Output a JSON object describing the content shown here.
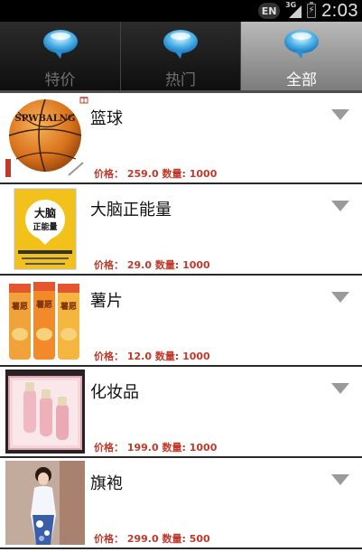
{
  "status_bar": {
    "language": "EN",
    "network": "3G",
    "time": "2:03"
  },
  "tabs": [
    {
      "label": "特价",
      "selected": false
    },
    {
      "label": "热门",
      "selected": false
    },
    {
      "label": "全部",
      "selected": true
    }
  ],
  "products": [
    {
      "name": "篮球",
      "price_label": "价格：",
      "price": "259.0",
      "qty_label": "数量:",
      "qty": "1000",
      "image": "basketball",
      "thumb_text": "SPWBALNG"
    },
    {
      "name": "大脑正能量",
      "price_label": "价格：",
      "price": "29.0",
      "qty_label": "数量:",
      "qty": "1000",
      "image": "book-cover",
      "thumb_text": "大脑正能量"
    },
    {
      "name": "薯片",
      "price_label": "价格：",
      "price": "12.0",
      "qty_label": "数量:",
      "qty": "1000",
      "image": "chips-cans",
      "thumb_text": "薯愿"
    },
    {
      "name": "化妆品",
      "price_label": "价格：",
      "price": "199.0",
      "qty_label": "数量:",
      "qty": "1000",
      "image": "cosmetics",
      "thumb_text": ""
    },
    {
      "name": "旗袍",
      "price_label": "价格：",
      "price": "299.0",
      "qty_label": "数量:",
      "qty": "500",
      "image": "qipao",
      "thumb_text": ""
    }
  ],
  "icons": {
    "tab_icon": "speech-bubble-icon",
    "expand_icon": "chevron-down-icon"
  },
  "colors": {
    "price_text": "#c0392b",
    "tab_selected_bg": "#9a9a9a",
    "tab_bg": "#1a1a1a"
  }
}
